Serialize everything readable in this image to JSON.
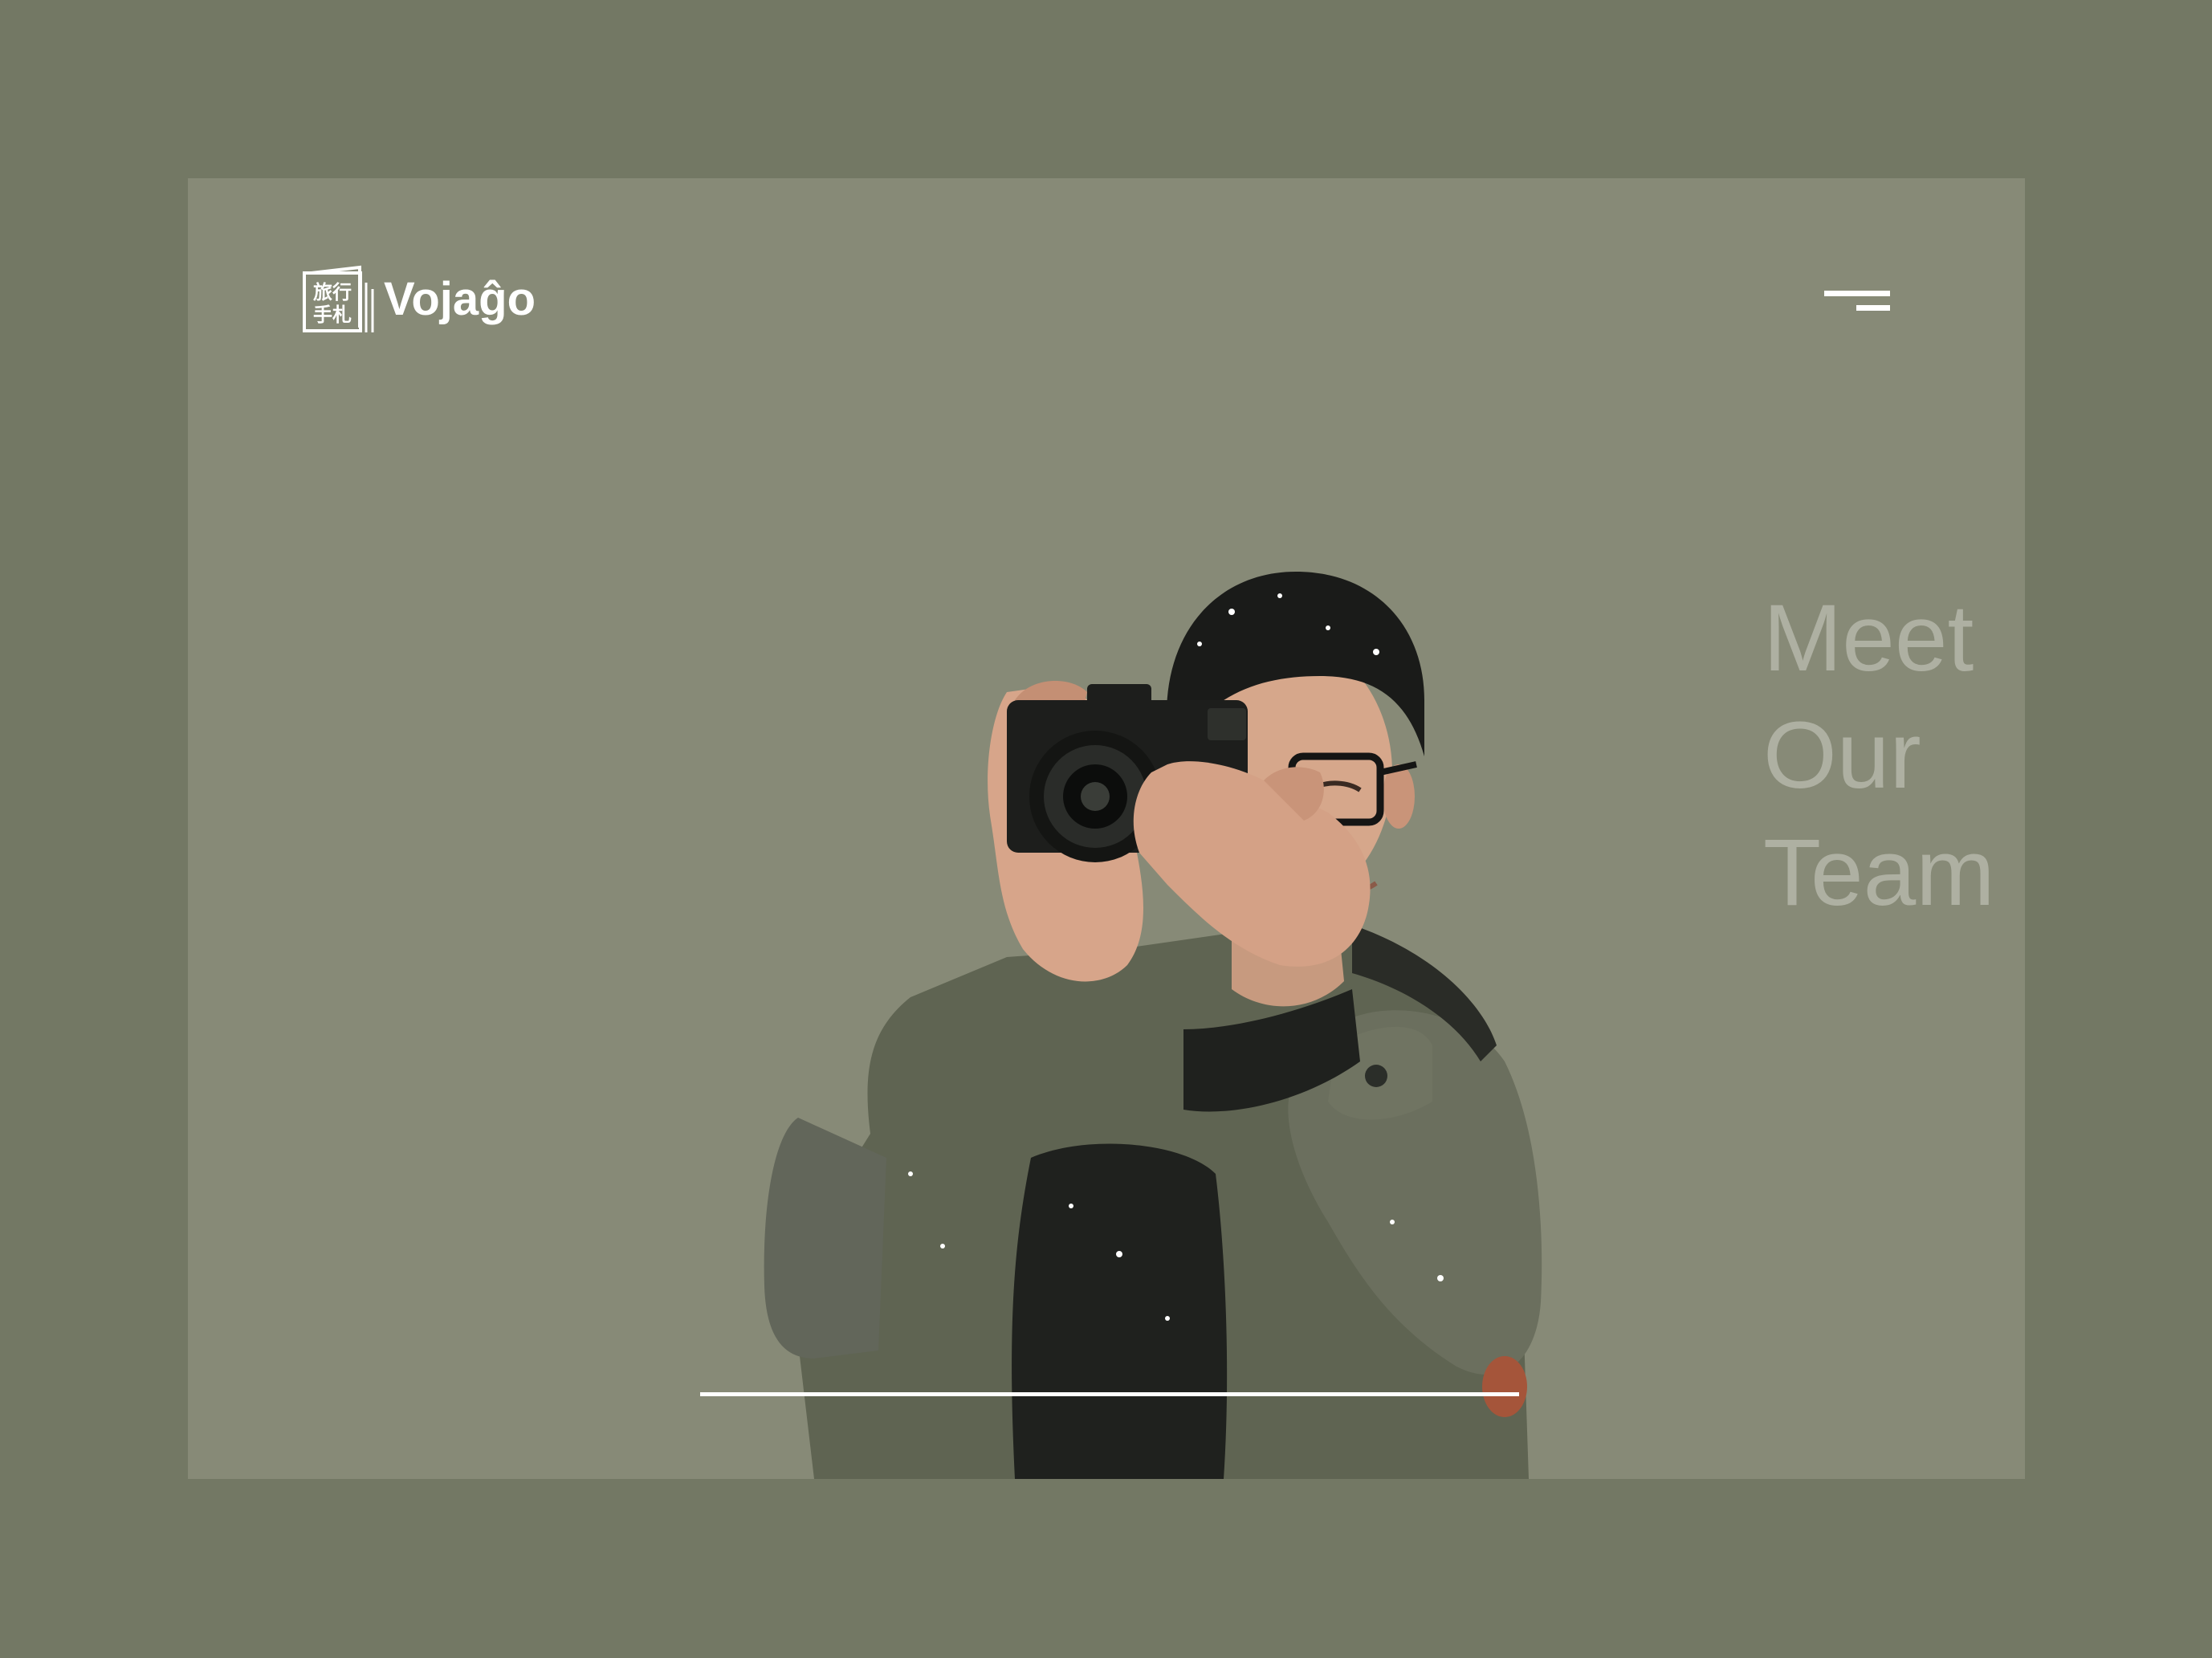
{
  "logo": {
    "mark_text_line1": "旅行",
    "mark_text_line2": "手札",
    "brand": "Vojaĝo"
  },
  "menu": {
    "icon": "hamburger-menu-icon"
  },
  "headline": {
    "line1": "Meet",
    "line2": "Our",
    "line3": "Team"
  },
  "hero": {
    "image": "photographer-with-camera"
  },
  "colors": {
    "outer_background": "#737864",
    "card_background": "#878a77",
    "headline": "#aeb0a2",
    "white": "#ffffff"
  }
}
